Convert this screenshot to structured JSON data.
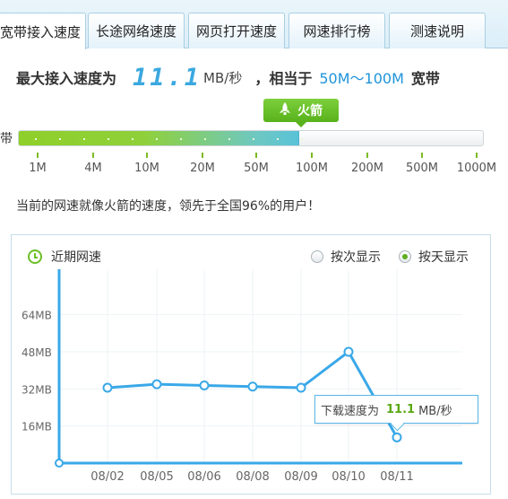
{
  "tabs": [
    {
      "label": "宽带接入速度",
      "active": true
    },
    {
      "label": "长途网络速度",
      "active": false
    },
    {
      "label": "网页打开速度",
      "active": false
    },
    {
      "label": "网速排行榜",
      "active": false
    },
    {
      "label": "测速说明",
      "active": false
    }
  ],
  "speed": {
    "prefix": "最大接入速度为",
    "value": "11.1",
    "unit": "MB/秒",
    "equiv_prefix": "，相当于",
    "range": "50M～100M",
    "suffix": "宽带"
  },
  "rocket": {
    "label": "火箭"
  },
  "band_label": "带",
  "progress": {
    "fraction": 0.605
  },
  "scale_ticks": [
    "1M",
    "4M",
    "10M",
    "20M",
    "50M",
    "100M",
    "200M",
    "500M",
    "1000M"
  ],
  "description": "当前的网速就像火箭的速度，领先于全国96%的用户！",
  "panel": {
    "title": "近期网速",
    "radio_by_count": "按次显示",
    "radio_by_day": "按天显示",
    "selected": "by_day"
  },
  "tooltip": {
    "prefix": "下载速度为",
    "value": "11.1",
    "unit": "MB/秒"
  },
  "chart_data": {
    "type": "line",
    "y_ticks": [
      "64MB",
      "48MB",
      "32MB",
      "16MB"
    ],
    "ylim": [
      0,
      72
    ],
    "categories": [
      "08/02",
      "08/05",
      "08/06",
      "08/08",
      "08/09",
      "08/10",
      "08/11"
    ],
    "values": [
      32.5,
      34,
      33.5,
      33,
      32.5,
      48,
      11.1
    ],
    "color": "#3aa8e8"
  }
}
